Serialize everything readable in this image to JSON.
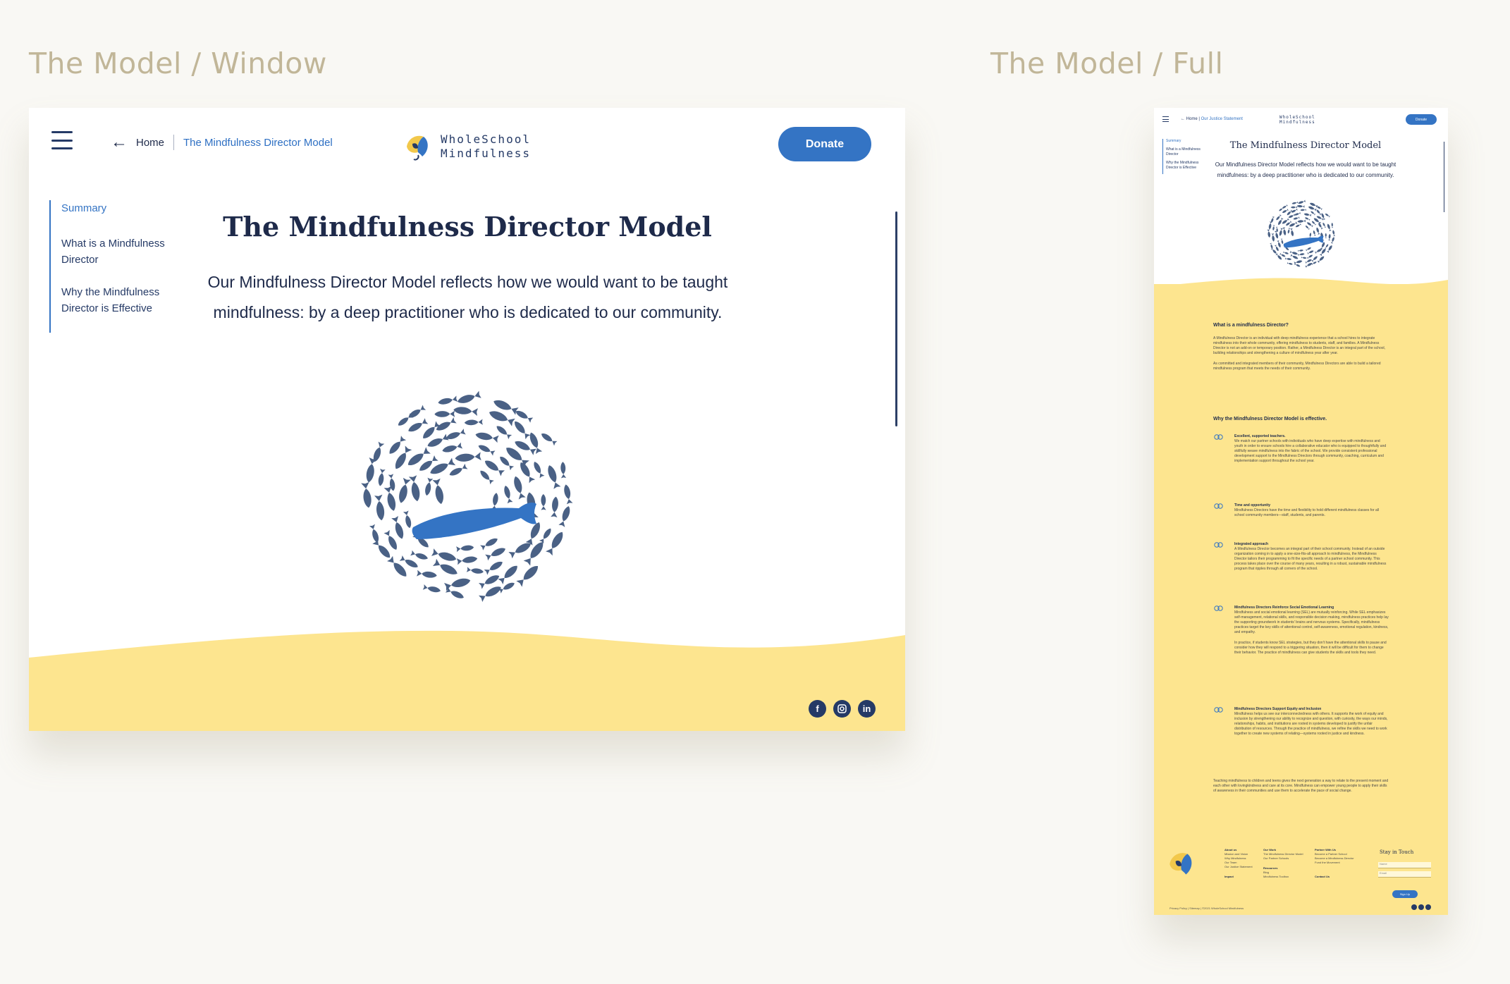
{
  "board": {
    "window_title": "The Model / Window",
    "full_title": "The Model / Full"
  },
  "nav": {
    "back_icon": "arrow-left-icon",
    "home": "Home",
    "current": "The Mindfulness Director Model",
    "full_current": "Our Justice Statement",
    "logo_line1": "WholeSchool",
    "logo_line2": "Mindfulness",
    "donate": "Donate"
  },
  "toc": [
    "Summary",
    "What is a Mindfulness Director",
    "Why the Mindfulness Director is Effective"
  ],
  "main": {
    "title": "The Mindfulness Director Model",
    "lead": "Our Mindfulness Director Model reflects how we would want to be taught mindfulness: by a deep practitioner who is dedicated to our community."
  },
  "socials": [
    "facebook-icon",
    "instagram-icon",
    "linkedin-icon"
  ],
  "colors": {
    "accent": "#3474c4",
    "navy": "#253a66",
    "yellow": "#fde58f",
    "fish": "#4a6185"
  },
  "full": {
    "section1_head": "What is a mindfulness Director?",
    "section1_p1": "A Mindfulness Director is an individual with deep mindfulness experience that a school hires to integrate mindfulness into their whole community, offering mindfulness to students, staff, and families. A Mindfulness Director is not an add-on or temporary position. Rather, a Mindfulness Director is an integral part of the school, building relationships and strengthening a culture of mindfulness year after year.",
    "section1_p2": "As committed and integrated members of their community, Mindfulness Directors are able to build a tailored mindfulness program that meets the needs of their community.",
    "section2_head": "Why the Mindfulness Director Model is effective.",
    "items": [
      {
        "title": "Excellent, supported teachers.",
        "body": "We match our partner schools with individuals who have deep expertise with mindfulness and youth in order to ensure schools hire a collaborative educator who is equipped to thoughtfully and skillfully weave mindfulness into the fabric of the school. We provide consistent professional development support to the Mindfulness Directors through community, coaching, curriculum and implementation support throughout the school year."
      },
      {
        "title": "Time and opportunity",
        "body": "Mindfulness Directors have the time and flexibility to hold different mindfulness classes for all school community members—staff, students, and parents."
      },
      {
        "title": "Integrated approach",
        "body": "A Mindfulness Director becomes an integral part of their school community. Instead of an outside organization coming in to apply a one-size-fits-all approach to mindfulness, the Mindfulness Director tailors their programming to fit the specific needs of a partner school community. This process takes place over the course of many years, resulting in a robust, sustainable mindfulness program that ripples through all corners of the school."
      },
      {
        "title": "Mindfulness Directors Reinforce Social Emotional Learning",
        "body": "Mindfulness and social emotional learning (SEL) are mutually reinforcing. While SEL emphasizes self-management, relational skills, and responsible decision making, mindfulness practices help lay the supporting groundwork in students' brains and nervous systems. Specifically, mindfulness practices target the key skills of attentional control, self-awareness, emotional regulation, kindness, and empathy.",
        "body2": "In practice, if students know SEL strategies, but they don't have the attentional skills to pause and consider how they will respond to a triggering situation, then it will be difficult for them to change their behavior. The practice of mindfulness can give students the skills and tools they need."
      },
      {
        "title": "Mindfulness Directors Support Equity and Inclusion",
        "body": "Mindfulness helps us see our interconnectedness with others. It supports the work of equity and inclusion by strengthening our ability to recognize and question, with curiosity, the ways our minds, relationships, habits, and institutions are rooted in systems developed to justify the unfair distribution of resources. Through the practice of mindfulness, we refine the skills we need to work together to create new systems of relating—systems rooted in justice and kindness."
      }
    ],
    "closing": "Teaching mindfulness to children and teens gives the next generation a way to relate to the present moment and each other with lovingkindness and care at its core. Mindfulness can empower young people to apply their skills of awareness in their communities and use them to accelerate the pace of social change.",
    "footer": {
      "about_head": "About us",
      "about_links": [
        "Mission and Vision",
        "Why Mindfulness",
        "Our Team",
        "Our Justice Statement"
      ],
      "work_head": "Our Work",
      "work_links": [
        "The Mindfulness Director Model",
        "Our Partner Schools"
      ],
      "resources_head": "Resources",
      "resources_links": [
        "Blog",
        "Mindfulness Toolbox"
      ],
      "partner_head": "Partner With Us",
      "partner_links": [
        "Become a Partner School",
        "Become a Mindfulness Director",
        "Fund the Movement"
      ],
      "impact": "Impact",
      "contact": "Contact Us",
      "stay": "Stay in Touch",
      "name_ph": "Name",
      "email_ph": "Email",
      "signup": "Sign Up",
      "legal": "Privacy Policy  |  Sitemap  |  ©2021 WholeSchool Mindfulness"
    }
  }
}
